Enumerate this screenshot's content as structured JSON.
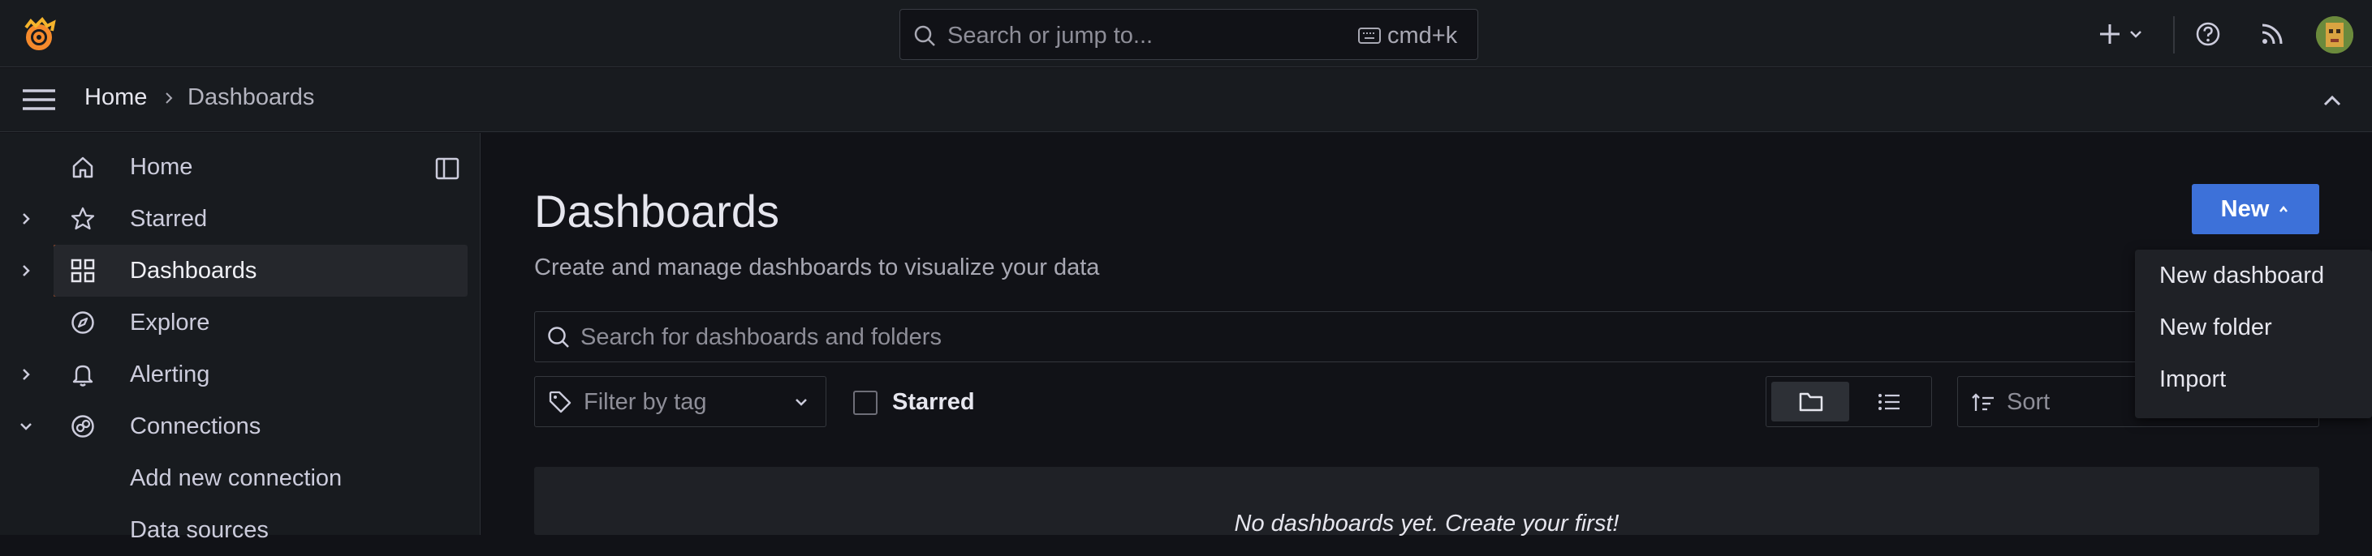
{
  "topbar": {
    "search_placeholder": "Search or jump to...",
    "search_shortcut": "cmd+k",
    "icons": [
      "grafana-logo-icon",
      "search-icon",
      "keyboard-icon",
      "plus-icon",
      "chevron-down-icon",
      "help-icon",
      "rss-icon",
      "avatar"
    ]
  },
  "breadcrumb": {
    "home": "Home",
    "current": "Dashboards"
  },
  "sidebar": {
    "items": [
      {
        "label": "Home",
        "icon": "home-icon",
        "expandable": false
      },
      {
        "label": "Starred",
        "icon": "star-icon",
        "expandable": true
      },
      {
        "label": "Dashboards",
        "icon": "apps-icon",
        "expandable": true,
        "active": true
      },
      {
        "label": "Explore",
        "icon": "compass-icon",
        "expandable": false
      },
      {
        "label": "Alerting",
        "icon": "bell-icon",
        "expandable": true
      },
      {
        "label": "Connections",
        "icon": "connections-icon",
        "expandable": true,
        "expanded": true
      },
      {
        "label": "Add new connection",
        "icon": "",
        "expandable": false
      },
      {
        "label": "Data sources",
        "icon": "",
        "expandable": false
      }
    ]
  },
  "main": {
    "title": "Dashboards",
    "subtitle": "Create and manage dashboards to visualize your data",
    "new_button": "New",
    "search_placeholder": "Search for dashboards and folders",
    "filter_placeholder": "Filter by tag",
    "starred_label": "Starred",
    "sort_placeholder": "Sort",
    "empty_message": "No dashboards yet. Create your first!"
  },
  "new_menu": {
    "items": [
      "New dashboard",
      "New folder",
      "Import"
    ]
  },
  "colors": {
    "accent": "#3d71d9",
    "active_indicator": "#f66a33",
    "background": "#111217",
    "panel": "#181b1f"
  }
}
